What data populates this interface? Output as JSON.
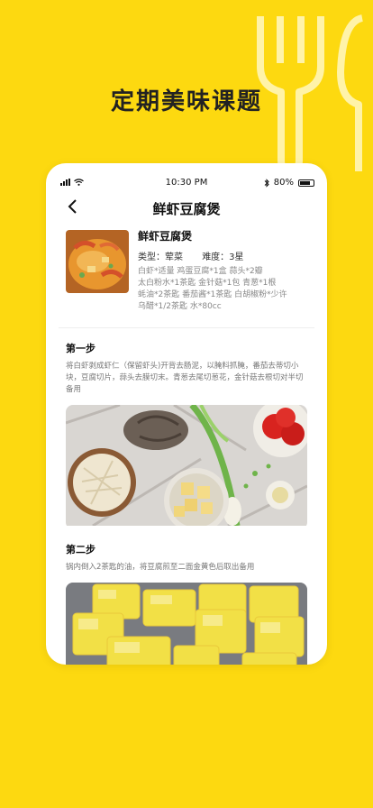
{
  "headline": "定期美味课题",
  "status_bar": {
    "time": "10:30 PM",
    "battery": "80%",
    "battery_level": 0.8
  },
  "nav": {
    "title": "鲜虾豆腐煲",
    "back_icon": "chevron-left-icon"
  },
  "recipe": {
    "name": "鲜虾豆腐煲",
    "type_label": "类型：荤菜",
    "difficulty_label": "难度：3星",
    "ingredients": [
      "白虾*适量 鸡蛋豆腐*1盒 蒜头*2瓣",
      "太白粉水*1茶匙 金针菇*1包 青葱*1根",
      "蚝油*2茶匙 番茄酱*1茶匙 白胡椒粉*少许",
      "乌醋*1/2茶匙 水*80cc"
    ]
  },
  "steps": [
    {
      "title": "第一步",
      "text": "将白虾剥成虾仁（保留虾头)开背去肠泥，以腌料抓腌，番茄去蒂切小块，豆腐切片，蒜头去膜切末。青葱去尾切葱花，金针菇去根切对半切备用"
    },
    {
      "title": "第二步",
      "text": "锅内倒入2茶匙的油，将豆腐煎至二面金黄色后取出备用"
    }
  ],
  "colors": {
    "background": "#FDD910",
    "card": "#FFFFFF"
  }
}
